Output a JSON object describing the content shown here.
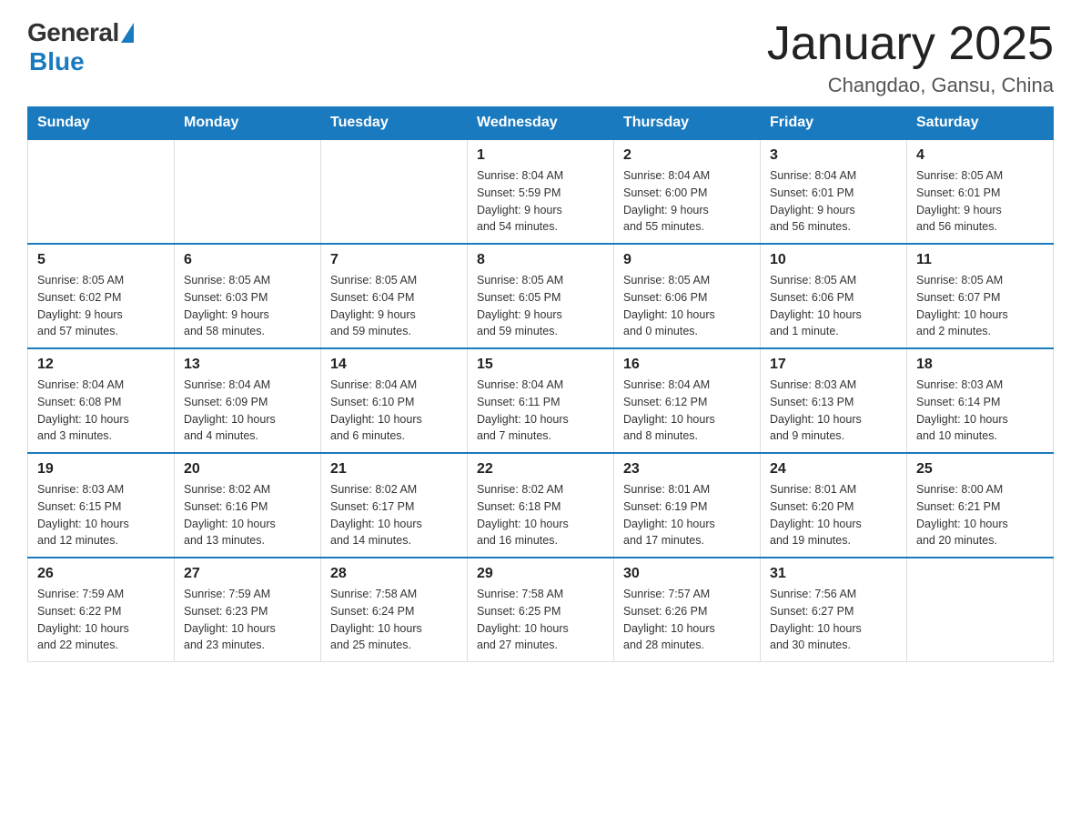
{
  "logo": {
    "general": "General",
    "blue": "Blue"
  },
  "title": "January 2025",
  "subtitle": "Changdao, Gansu, China",
  "days_of_week": [
    "Sunday",
    "Monday",
    "Tuesday",
    "Wednesday",
    "Thursday",
    "Friday",
    "Saturday"
  ],
  "weeks": [
    [
      {
        "day": "",
        "info": ""
      },
      {
        "day": "",
        "info": ""
      },
      {
        "day": "",
        "info": ""
      },
      {
        "day": "1",
        "info": "Sunrise: 8:04 AM\nSunset: 5:59 PM\nDaylight: 9 hours\nand 54 minutes."
      },
      {
        "day": "2",
        "info": "Sunrise: 8:04 AM\nSunset: 6:00 PM\nDaylight: 9 hours\nand 55 minutes."
      },
      {
        "day": "3",
        "info": "Sunrise: 8:04 AM\nSunset: 6:01 PM\nDaylight: 9 hours\nand 56 minutes."
      },
      {
        "day": "4",
        "info": "Sunrise: 8:05 AM\nSunset: 6:01 PM\nDaylight: 9 hours\nand 56 minutes."
      }
    ],
    [
      {
        "day": "5",
        "info": "Sunrise: 8:05 AM\nSunset: 6:02 PM\nDaylight: 9 hours\nand 57 minutes."
      },
      {
        "day": "6",
        "info": "Sunrise: 8:05 AM\nSunset: 6:03 PM\nDaylight: 9 hours\nand 58 minutes."
      },
      {
        "day": "7",
        "info": "Sunrise: 8:05 AM\nSunset: 6:04 PM\nDaylight: 9 hours\nand 59 minutes."
      },
      {
        "day": "8",
        "info": "Sunrise: 8:05 AM\nSunset: 6:05 PM\nDaylight: 9 hours\nand 59 minutes."
      },
      {
        "day": "9",
        "info": "Sunrise: 8:05 AM\nSunset: 6:06 PM\nDaylight: 10 hours\nand 0 minutes."
      },
      {
        "day": "10",
        "info": "Sunrise: 8:05 AM\nSunset: 6:06 PM\nDaylight: 10 hours\nand 1 minute."
      },
      {
        "day": "11",
        "info": "Sunrise: 8:05 AM\nSunset: 6:07 PM\nDaylight: 10 hours\nand 2 minutes."
      }
    ],
    [
      {
        "day": "12",
        "info": "Sunrise: 8:04 AM\nSunset: 6:08 PM\nDaylight: 10 hours\nand 3 minutes."
      },
      {
        "day": "13",
        "info": "Sunrise: 8:04 AM\nSunset: 6:09 PM\nDaylight: 10 hours\nand 4 minutes."
      },
      {
        "day": "14",
        "info": "Sunrise: 8:04 AM\nSunset: 6:10 PM\nDaylight: 10 hours\nand 6 minutes."
      },
      {
        "day": "15",
        "info": "Sunrise: 8:04 AM\nSunset: 6:11 PM\nDaylight: 10 hours\nand 7 minutes."
      },
      {
        "day": "16",
        "info": "Sunrise: 8:04 AM\nSunset: 6:12 PM\nDaylight: 10 hours\nand 8 minutes."
      },
      {
        "day": "17",
        "info": "Sunrise: 8:03 AM\nSunset: 6:13 PM\nDaylight: 10 hours\nand 9 minutes."
      },
      {
        "day": "18",
        "info": "Sunrise: 8:03 AM\nSunset: 6:14 PM\nDaylight: 10 hours\nand 10 minutes."
      }
    ],
    [
      {
        "day": "19",
        "info": "Sunrise: 8:03 AM\nSunset: 6:15 PM\nDaylight: 10 hours\nand 12 minutes."
      },
      {
        "day": "20",
        "info": "Sunrise: 8:02 AM\nSunset: 6:16 PM\nDaylight: 10 hours\nand 13 minutes."
      },
      {
        "day": "21",
        "info": "Sunrise: 8:02 AM\nSunset: 6:17 PM\nDaylight: 10 hours\nand 14 minutes."
      },
      {
        "day": "22",
        "info": "Sunrise: 8:02 AM\nSunset: 6:18 PM\nDaylight: 10 hours\nand 16 minutes."
      },
      {
        "day": "23",
        "info": "Sunrise: 8:01 AM\nSunset: 6:19 PM\nDaylight: 10 hours\nand 17 minutes."
      },
      {
        "day": "24",
        "info": "Sunrise: 8:01 AM\nSunset: 6:20 PM\nDaylight: 10 hours\nand 19 minutes."
      },
      {
        "day": "25",
        "info": "Sunrise: 8:00 AM\nSunset: 6:21 PM\nDaylight: 10 hours\nand 20 minutes."
      }
    ],
    [
      {
        "day": "26",
        "info": "Sunrise: 7:59 AM\nSunset: 6:22 PM\nDaylight: 10 hours\nand 22 minutes."
      },
      {
        "day": "27",
        "info": "Sunrise: 7:59 AM\nSunset: 6:23 PM\nDaylight: 10 hours\nand 23 minutes."
      },
      {
        "day": "28",
        "info": "Sunrise: 7:58 AM\nSunset: 6:24 PM\nDaylight: 10 hours\nand 25 minutes."
      },
      {
        "day": "29",
        "info": "Sunrise: 7:58 AM\nSunset: 6:25 PM\nDaylight: 10 hours\nand 27 minutes."
      },
      {
        "day": "30",
        "info": "Sunrise: 7:57 AM\nSunset: 6:26 PM\nDaylight: 10 hours\nand 28 minutes."
      },
      {
        "day": "31",
        "info": "Sunrise: 7:56 AM\nSunset: 6:27 PM\nDaylight: 10 hours\nand 30 minutes."
      },
      {
        "day": "",
        "info": ""
      }
    ]
  ]
}
